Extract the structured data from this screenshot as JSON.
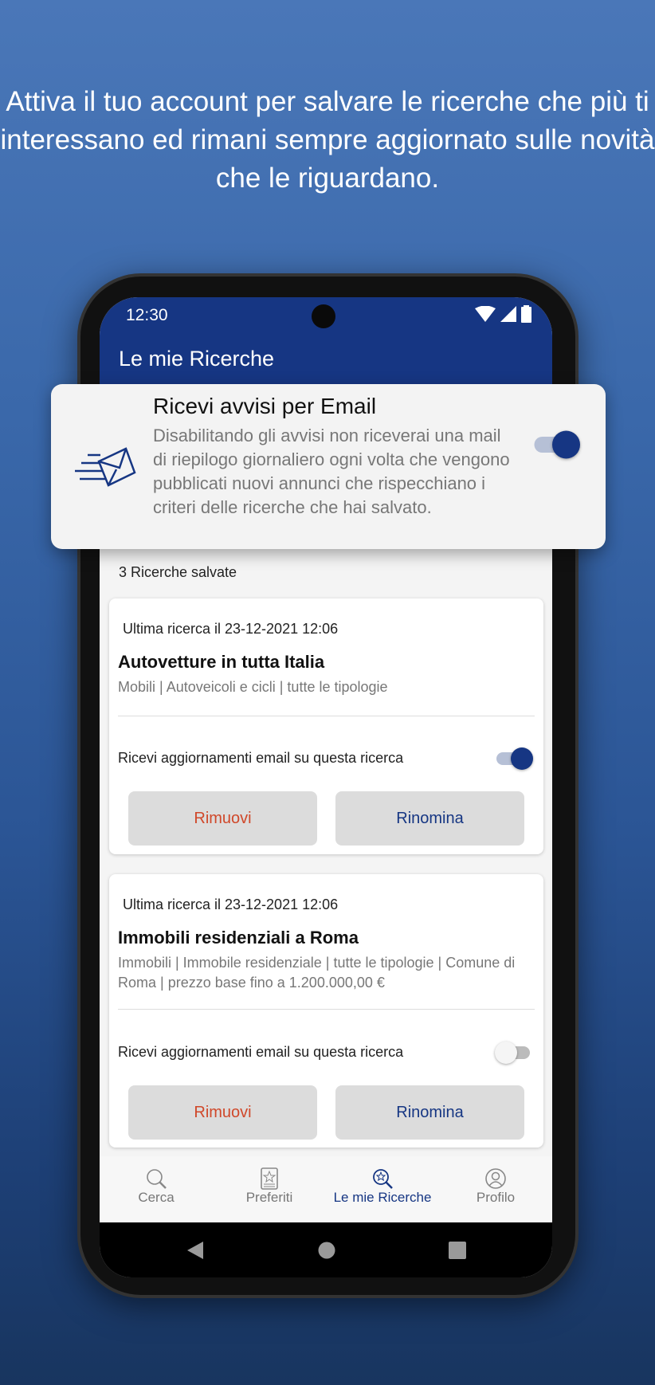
{
  "headline": "Attiva il tuo account per salvare le ricerche che più ti interessano ed rimani sempre aggiornato sulle novità che le riguardano.",
  "status_bar": {
    "time": "12:30"
  },
  "app_bar": {
    "title": "Le mie Ricerche"
  },
  "email_alerts": {
    "title": "Ricevi avvisi per Email",
    "description": "Disabilitando gli avvisi non riceverai una mail di riepilogo giornaliero ogni volta che vengono pubblicati nuovi annunci che rispecchiano i criteri delle ricerche che hai salvato.",
    "enabled": true
  },
  "saved_count": "3 Ricerche salvate",
  "searches": [
    {
      "date": "Ultima ricerca il 23-12-2021 12:06",
      "title": "Autovetture in tutta Italia",
      "subtitle": "Mobili | Autoveicoli e cicli | tutte le tipologie",
      "toggle_label": "Ricevi aggiornamenti email su questa ricerca",
      "email_updates": true,
      "remove_label": "Rimuovi",
      "rename_label": "Rinomina"
    },
    {
      "date": "Ultima ricerca il 23-12-2021 12:06",
      "title": "Immobili residenziali a Roma",
      "subtitle": "Immobili | Immobile residenziale | tutte le tipologie | Comune di Roma | prezzo base fino a 1.200.000,00 €",
      "toggle_label": "Ricevi aggiornamenti email su questa ricerca",
      "email_updates": false,
      "remove_label": "Rimuovi",
      "rename_label": "Rinomina"
    }
  ],
  "bottom_nav": [
    {
      "label": "Cerca",
      "icon": "search-icon"
    },
    {
      "label": "Preferiti",
      "icon": "favorites-icon"
    },
    {
      "label": "Le mie Ricerche",
      "icon": "saved-search-icon",
      "active": true
    },
    {
      "label": "Profilo",
      "icon": "profile-icon"
    }
  ],
  "colors": {
    "primary": "#163683",
    "remove": "#d0482a"
  }
}
